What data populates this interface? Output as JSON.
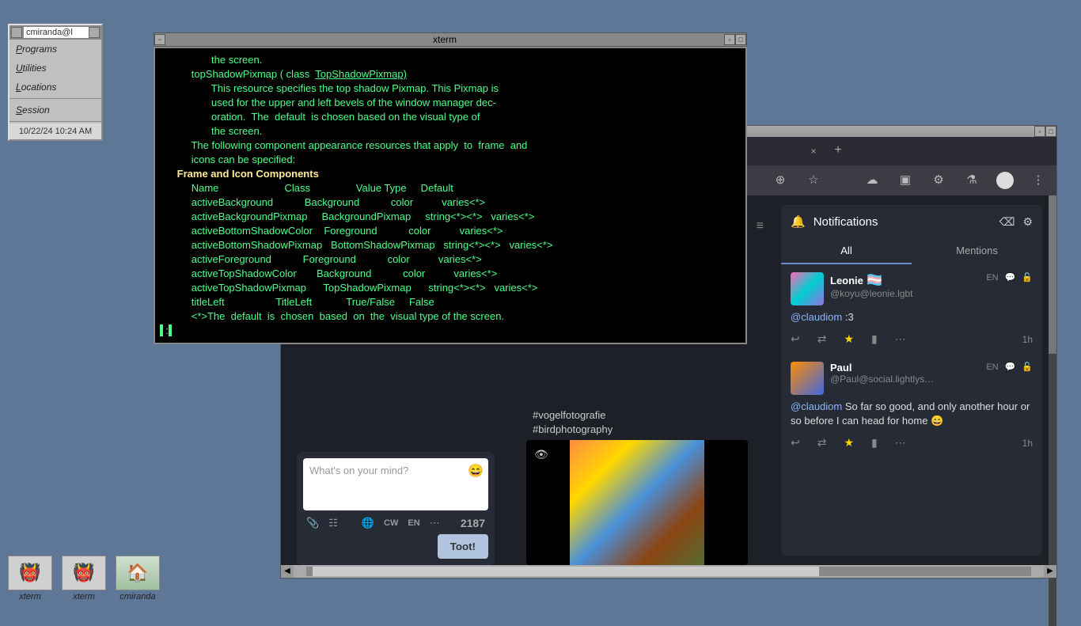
{
  "desktop_menu": {
    "title": "cmiranda@l",
    "items": [
      "Programs",
      "Utilities",
      "Locations",
      "Session"
    ],
    "time": "10/22/24 10:24 AM"
  },
  "xterm": {
    "title": "xterm",
    "lines": [
      "                  the screen.",
      "",
      "           topShadowPixmap ( class  ",
      "TopShadowPixmap)",
      "                  This resource specifies the top shadow Pixmap. This Pixmap is",
      "                  used for the upper and left bevels of the window manager dec-",
      "                  oration.  The  default  is chosen based on the visual type of",
      "                  the screen.",
      "",
      "           The following component appearance resources that apply  to  frame  and",
      "           icons can be specified:",
      "",
      "      Frame and Icon Components",
      "           Name                       Class                Value Type     Default",
      "           activeBackground           Background           color          varies<*>",
      "           activeBackgroundPixmap     BackgroundPixmap     string<*><*>   varies<*>",
      "           activeBottomShadowColor    Foreground           color          varies<*>",
      "           activeBottomShadowPixmap   BottomShadowPixmap   string<*><*>   varies<*>",
      "           activeForeground           Foreground           color          varies<*>",
      "           activeTopShadowColor       Background           color          varies<*>",
      "           activeTopShadowPixmap      TopShadowPixmap      string<*><*>   varies<*>",
      "           titleLeft                  TitleLeft            True/False     False",
      "",
      "           <*>The  default  is  chosen  based  on  the  visual type of the screen."
    ],
    "prompt": ":"
  },
  "browser": {
    "toolbar_icons": [
      "install",
      "star",
      "cloud",
      "shield",
      "ext",
      "flask",
      "profile",
      "menu"
    ]
  },
  "compose": {
    "placeholder": "What's on your mind?",
    "cw": "CW",
    "lang": "EN",
    "count": "2187",
    "button": "Toot!"
  },
  "feed": {
    "tags": [
      "#vogelfotografie",
      "#birdphotography"
    ]
  },
  "notifications": {
    "title": "Notifications",
    "tabs": [
      "All",
      "Mentions"
    ],
    "items": [
      {
        "name": "Leonie",
        "flag": "🏳️‍⚧️",
        "handle": "@koyu@leonie.lgbt",
        "lang": "EN",
        "body_mention": "@claudiom",
        "body_text": " :3",
        "time": "1h"
      },
      {
        "name": "Paul",
        "handle": "@Paul@social.lightlys…",
        "lang": "EN",
        "body_mention": "@claudiom",
        "body_text": " So far so good, and only another hour or so before I can head for home 😄",
        "time": "1h"
      }
    ]
  },
  "desktop_icons": [
    {
      "label": "xterm",
      "glyph": "👹"
    },
    {
      "label": "xterm",
      "glyph": "👹"
    },
    {
      "label": "cmiranda",
      "glyph": "🏠"
    }
  ]
}
